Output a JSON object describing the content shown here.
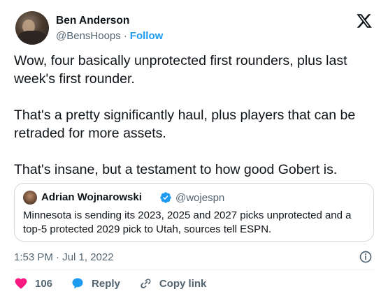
{
  "author": {
    "name": "Ben Anderson",
    "handle": "@BensHoops",
    "separator": "·",
    "follow_label": "Follow"
  },
  "tweet": {
    "paragraphs": [
      "Wow, four basically unprotected first rounders, plus last week's first rounder.",
      "That's a pretty significantly haul, plus players that can be retraded for more assets.",
      "That's insane, but a testament to how good Gobert is."
    ]
  },
  "quote": {
    "name": "Adrian Wojnarowski",
    "handle": "@wojespn",
    "text": "Minnesota is sending its 2023, 2025 and 2027 picks unprotected and a top-5 protected 2029 pick to Utah, sources tell ESPN."
  },
  "timestamp": "1:53 PM · Jul 1, 2022",
  "actions": {
    "likes": "106",
    "reply_label": "Reply",
    "copy_label": "Copy link"
  },
  "colors": {
    "accent": "#1d9bf0",
    "like": "#f91880",
    "text": "#0f1419",
    "muted": "#536471",
    "border": "#cfd9de"
  },
  "icons": [
    "x-logo-icon",
    "verified-badge-icon",
    "info-icon",
    "heart-icon",
    "reply-bubble-icon",
    "link-icon"
  ]
}
